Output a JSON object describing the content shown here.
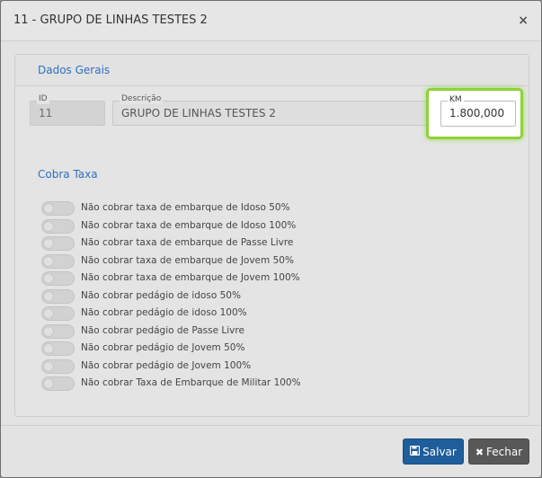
{
  "modal": {
    "title": "11 - GRUPO DE LINHAS TESTES 2",
    "close_symbol": "×"
  },
  "dados_gerais": {
    "title": "Dados Gerais",
    "id": {
      "label": "ID",
      "value": "11"
    },
    "descricao": {
      "label": "Descrição",
      "value": "GRUPO DE LINHAS TESTES 2"
    },
    "km": {
      "label": "KM",
      "value": "1.800,000"
    }
  },
  "cobra_taxa": {
    "title": "Cobra Taxa",
    "toggles": [
      {
        "label": "Não cobrar taxa de embarque de Idoso 50%",
        "on": false
      },
      {
        "label": "Não cobrar taxa de embarque de Idoso 100%",
        "on": false
      },
      {
        "label": "Não cobrar taxa de embarque de Passe Livre",
        "on": false
      },
      {
        "label": "Não cobrar taxa de embarque de Jovem 50%",
        "on": false
      },
      {
        "label": "Não cobrar taxa de embarque de Jovem 100%",
        "on": false
      },
      {
        "label": "Não cobrar pedágio de idoso 50%",
        "on": false
      },
      {
        "label": "Não cobrar pedágio de idoso 100%",
        "on": false
      },
      {
        "label": "Não cobrar pedágio de Passe Livre",
        "on": false
      },
      {
        "label": "Não cobrar pedágio de Jovem 50%",
        "on": false
      },
      {
        "label": "Não cobrar pedágio de Jovem 100%",
        "on": false
      },
      {
        "label": "Não cobrar Taxa de Embarque de Militar 100%",
        "on": false
      }
    ]
  },
  "footer": {
    "save_label": "Salvar",
    "close_label": "Fechar",
    "save_icon": "floppy-disk-icon",
    "close_icon": "x-icon"
  },
  "colors": {
    "accent_title": "#2f6fbf",
    "save_button": "#1f5d9b",
    "close_button": "#585858",
    "highlight": "#8fd13b"
  }
}
